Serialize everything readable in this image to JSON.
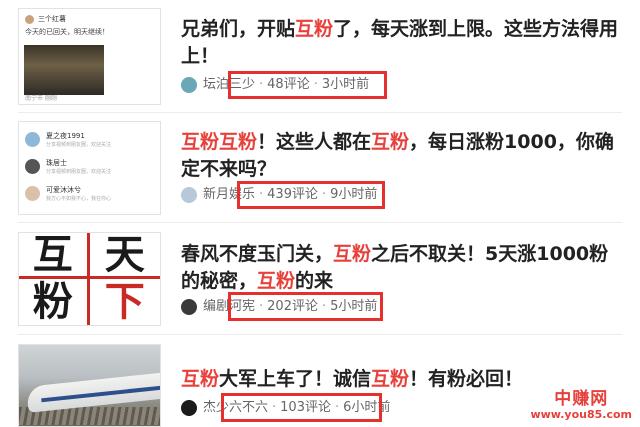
{
  "colors": {
    "highlight": "#e8403b",
    "box": "#e5302d",
    "meta_text": "#666666"
  },
  "articles": [
    {
      "title": [
        {
          "text": "兄弟们，开贴",
          "hl": false
        },
        {
          "text": "互粉",
          "hl": true
        },
        {
          "text": "了，每天涨到上限。这些方法得用上！",
          "hl": false
        }
      ],
      "author": "坛泊三少",
      "comments": "48评论",
      "time": "3小时前",
      "thumb": {
        "group_name": "三个红薯",
        "message": "今天的已回关，明天继续！",
        "footer": "南宁市 刚刚"
      }
    },
    {
      "title": [
        {
          "text": "互粉互粉",
          "hl": true
        },
        {
          "text": "！这些人都在",
          "hl": false
        },
        {
          "text": "互粉",
          "hl": true
        },
        {
          "text": "，每日涨粉1000，你确定不来吗？",
          "hl": false
        }
      ],
      "author": "新月娱乐",
      "comments": "439评论",
      "time": "9小时前",
      "thumb": {
        "chats": [
          {
            "name": "夏之夜1991",
            "sub": "分享视频到朋友圈，欢迎关注",
            "color": "#8fb8d8"
          },
          {
            "name": "珠居士",
            "sub": "分享视频到朋友圈，欢迎关注",
            "color": "#555555"
          },
          {
            "name": "可爱沐沐兮",
            "sub": "我方心不如我不心，我在你心",
            "color": "#d9c1a8"
          }
        ]
      }
    },
    {
      "title": [
        {
          "text": "春风不度玉门关，",
          "hl": false
        },
        {
          "text": "互粉",
          "hl": true
        },
        {
          "text": "之后不取关！5天涨1000粉的秘密，",
          "hl": false
        },
        {
          "text": "互粉",
          "hl": true
        },
        {
          "text": "的来",
          "hl": false
        }
      ],
      "author": "编剧河宪",
      "comments": "202评论",
      "time": "5小时前",
      "thumb": {
        "chars": [
          "互",
          "天",
          "粉",
          "下"
        ]
      }
    },
    {
      "title": [
        {
          "text": "互粉",
          "hl": true
        },
        {
          "text": "大军上车了！诚信",
          "hl": false
        },
        {
          "text": "互粉",
          "hl": true
        },
        {
          "text": "！有粉必回！",
          "hl": false
        }
      ],
      "author": "杰少六不六",
      "comments": "103评论",
      "time": "6小时前",
      "thumb": {}
    }
  ],
  "watermark": {
    "main": "中赚网",
    "sub": "www.you85.com"
  }
}
